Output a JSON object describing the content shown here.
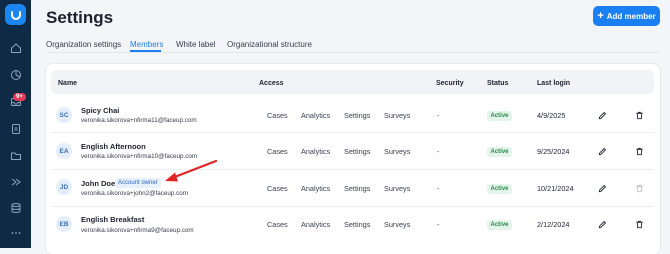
{
  "header": {
    "title": "Settings",
    "add_member_label": "Add member"
  },
  "tabs": [
    {
      "label": "Organization settings"
    },
    {
      "label": "Members"
    },
    {
      "label": "White label"
    },
    {
      "label": "Organizational structure"
    }
  ],
  "sidebar": {
    "notification_badge": "9+"
  },
  "table": {
    "columns": [
      "Name",
      "Access",
      "Security",
      "Status",
      "Last login"
    ],
    "access_labels": [
      "Cases",
      "Analytics",
      "Settings",
      "Surveys"
    ],
    "rows": [
      {
        "initials": "SC",
        "name": "Spicy Chai",
        "email": "veronika.sikorova+nfirma11@faceup.com",
        "tag": "",
        "security": "-",
        "status": "Active",
        "last_login": "4/9/2025"
      },
      {
        "initials": "EA",
        "name": "English Afternoon",
        "email": "veronika.sikorova+nfirma10@faceup.com",
        "tag": "",
        "security": "-",
        "status": "Active",
        "last_login": "9/25/2024"
      },
      {
        "initials": "JD",
        "name": "John Doe",
        "email": "veronika.sikorova+john2@faceup.com",
        "tag": "Account owner",
        "security": "-",
        "status": "Active",
        "last_login": "10/21/2024"
      },
      {
        "initials": "EB",
        "name": "English Breakfast",
        "email": "veronika.sikorova+nfirma9@faceup.com",
        "tag": "",
        "security": "-",
        "status": "Active",
        "last_login": "2/12/2024"
      }
    ]
  },
  "colors": {
    "accent": "#1a7ff0",
    "sidebar": "#0f2a44",
    "active_status": "#2b8a4c",
    "annotation_arrow": "#e02424"
  }
}
